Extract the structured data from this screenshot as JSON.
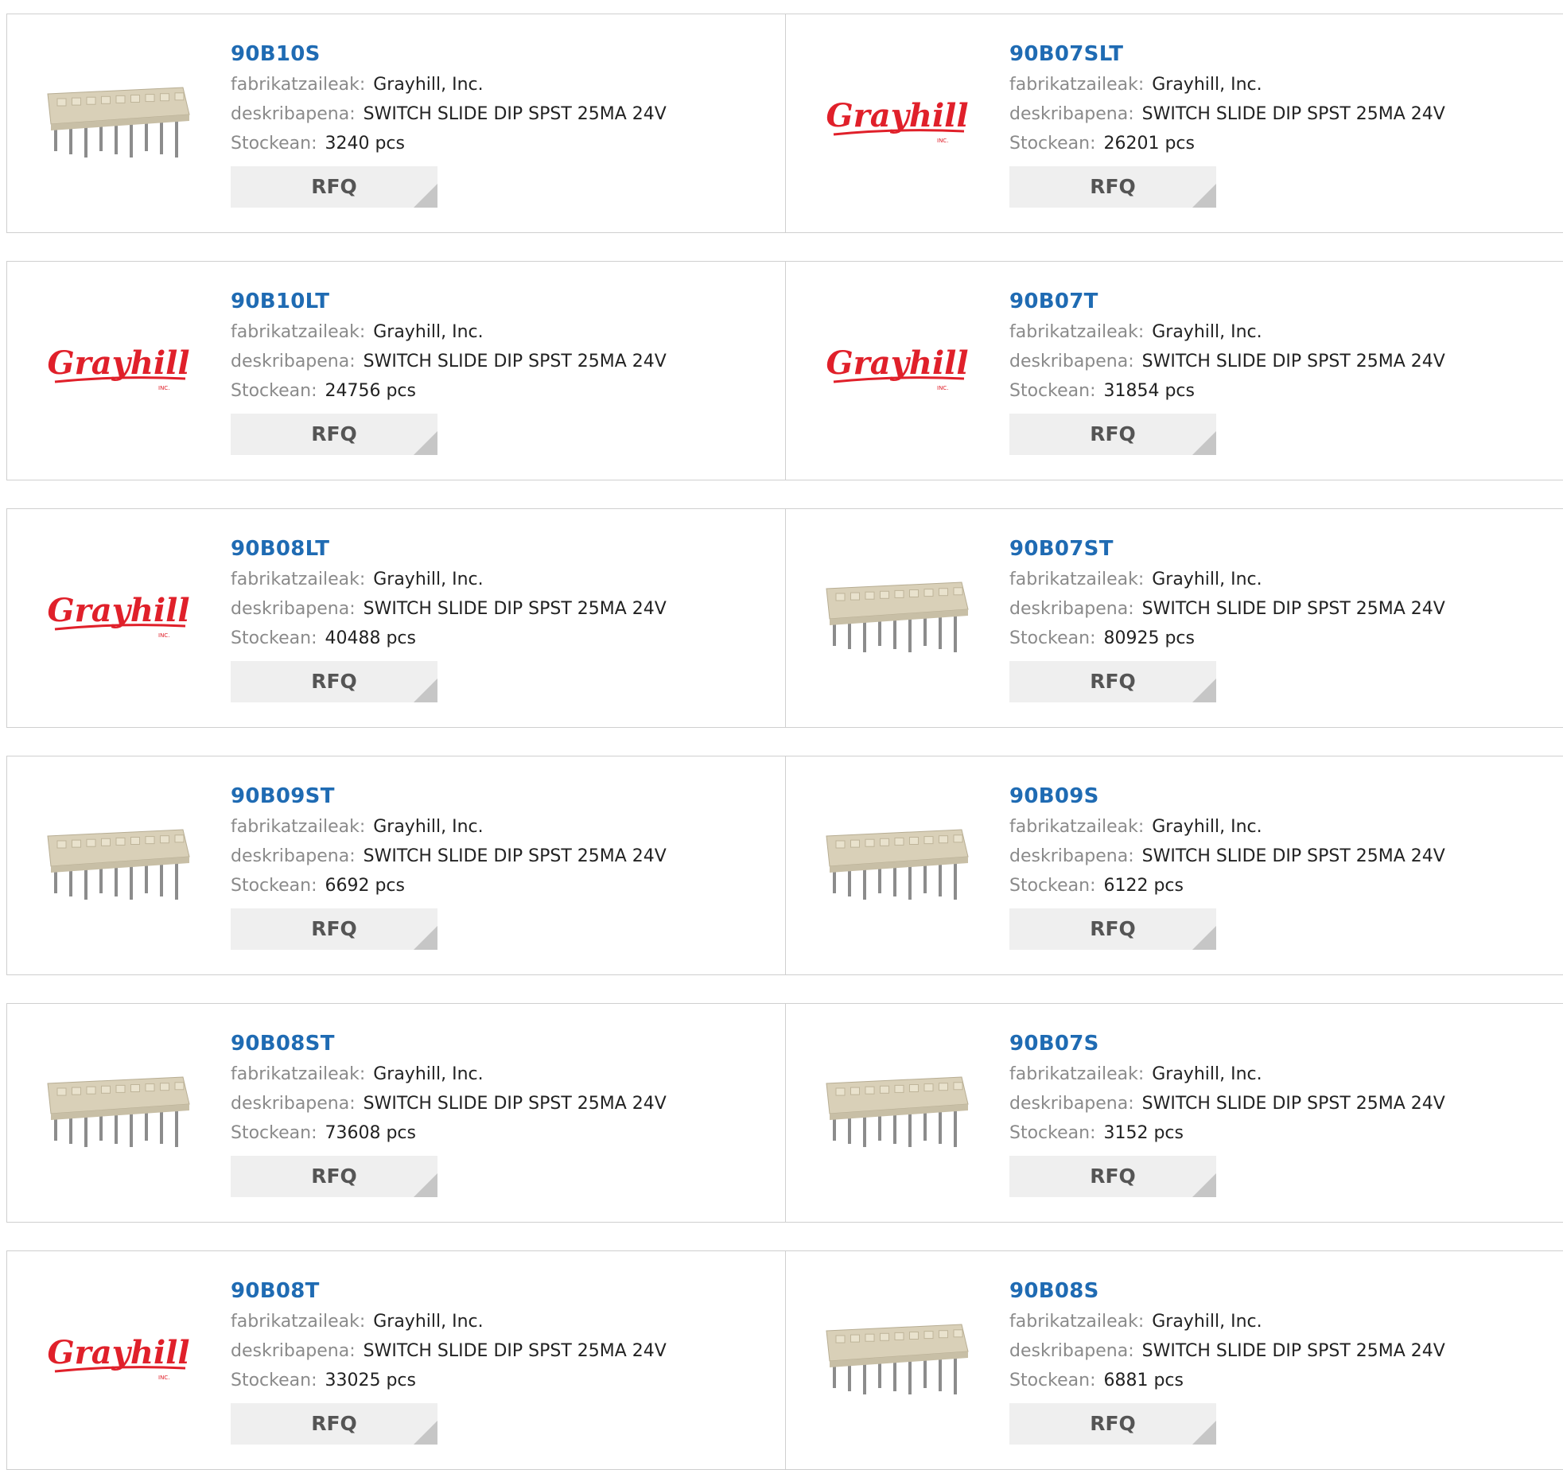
{
  "labels": {
    "manufacturer": "fabrikatzaileak:",
    "description": "deskribapena:",
    "stock": "Stockean:",
    "rfq": "RFQ"
  },
  "brand": {
    "logo_text": "Grayhill",
    "logo_sub": "INC.",
    "logo_color": "#e0202a",
    "part_link_color": "#1f6bb3"
  },
  "products": [
    {
      "pn": "90B10S",
      "manufacturer": "Grayhill, Inc.",
      "description": "SWITCH SLIDE DIP SPST 25MA 24V",
      "stock": "3240 pcs",
      "image": "dip-switch-photo"
    },
    {
      "pn": "90B07SLT",
      "manufacturer": "Grayhill, Inc.",
      "description": "SWITCH SLIDE DIP SPST 25MA 24V",
      "stock": "26201 pcs",
      "image": "grayhill-logo"
    },
    {
      "pn": "90B10LT",
      "manufacturer": "Grayhill, Inc.",
      "description": "SWITCH SLIDE DIP SPST 25MA 24V",
      "stock": "24756 pcs",
      "image": "grayhill-logo"
    },
    {
      "pn": "90B07T",
      "manufacturer": "Grayhill, Inc.",
      "description": "SWITCH SLIDE DIP SPST 25MA 24V",
      "stock": "31854 pcs",
      "image": "grayhill-logo"
    },
    {
      "pn": "90B08LT",
      "manufacturer": "Grayhill, Inc.",
      "description": "SWITCH SLIDE DIP SPST 25MA 24V",
      "stock": "40488 pcs",
      "image": "grayhill-logo"
    },
    {
      "pn": "90B07ST",
      "manufacturer": "Grayhill, Inc.",
      "description": "SWITCH SLIDE DIP SPST 25MA 24V",
      "stock": "80925 pcs",
      "image": "dip-switch-photo"
    },
    {
      "pn": "90B09ST",
      "manufacturer": "Grayhill, Inc.",
      "description": "SWITCH SLIDE DIP SPST 25MA 24V",
      "stock": "6692 pcs",
      "image": "dip-switch-photo"
    },
    {
      "pn": "90B09S",
      "manufacturer": "Grayhill, Inc.",
      "description": "SWITCH SLIDE DIP SPST 25MA 24V",
      "stock": "6122 pcs",
      "image": "dip-switch-photo"
    },
    {
      "pn": "90B08ST",
      "manufacturer": "Grayhill, Inc.",
      "description": "SWITCH SLIDE DIP SPST 25MA 24V",
      "stock": "73608 pcs",
      "image": "dip-switch-photo"
    },
    {
      "pn": "90B07S",
      "manufacturer": "Grayhill, Inc.",
      "description": "SWITCH SLIDE DIP SPST 25MA 24V",
      "stock": "3152 pcs",
      "image": "dip-switch-photo"
    },
    {
      "pn": "90B08T",
      "manufacturer": "Grayhill, Inc.",
      "description": "SWITCH SLIDE DIP SPST 25MA 24V",
      "stock": "33025 pcs",
      "image": "grayhill-logo"
    },
    {
      "pn": "90B08S",
      "manufacturer": "Grayhill, Inc.",
      "description": "SWITCH SLIDE DIP SPST 25MA 24V",
      "stock": "6881 pcs",
      "image": "dip-switch-photo"
    }
  ]
}
